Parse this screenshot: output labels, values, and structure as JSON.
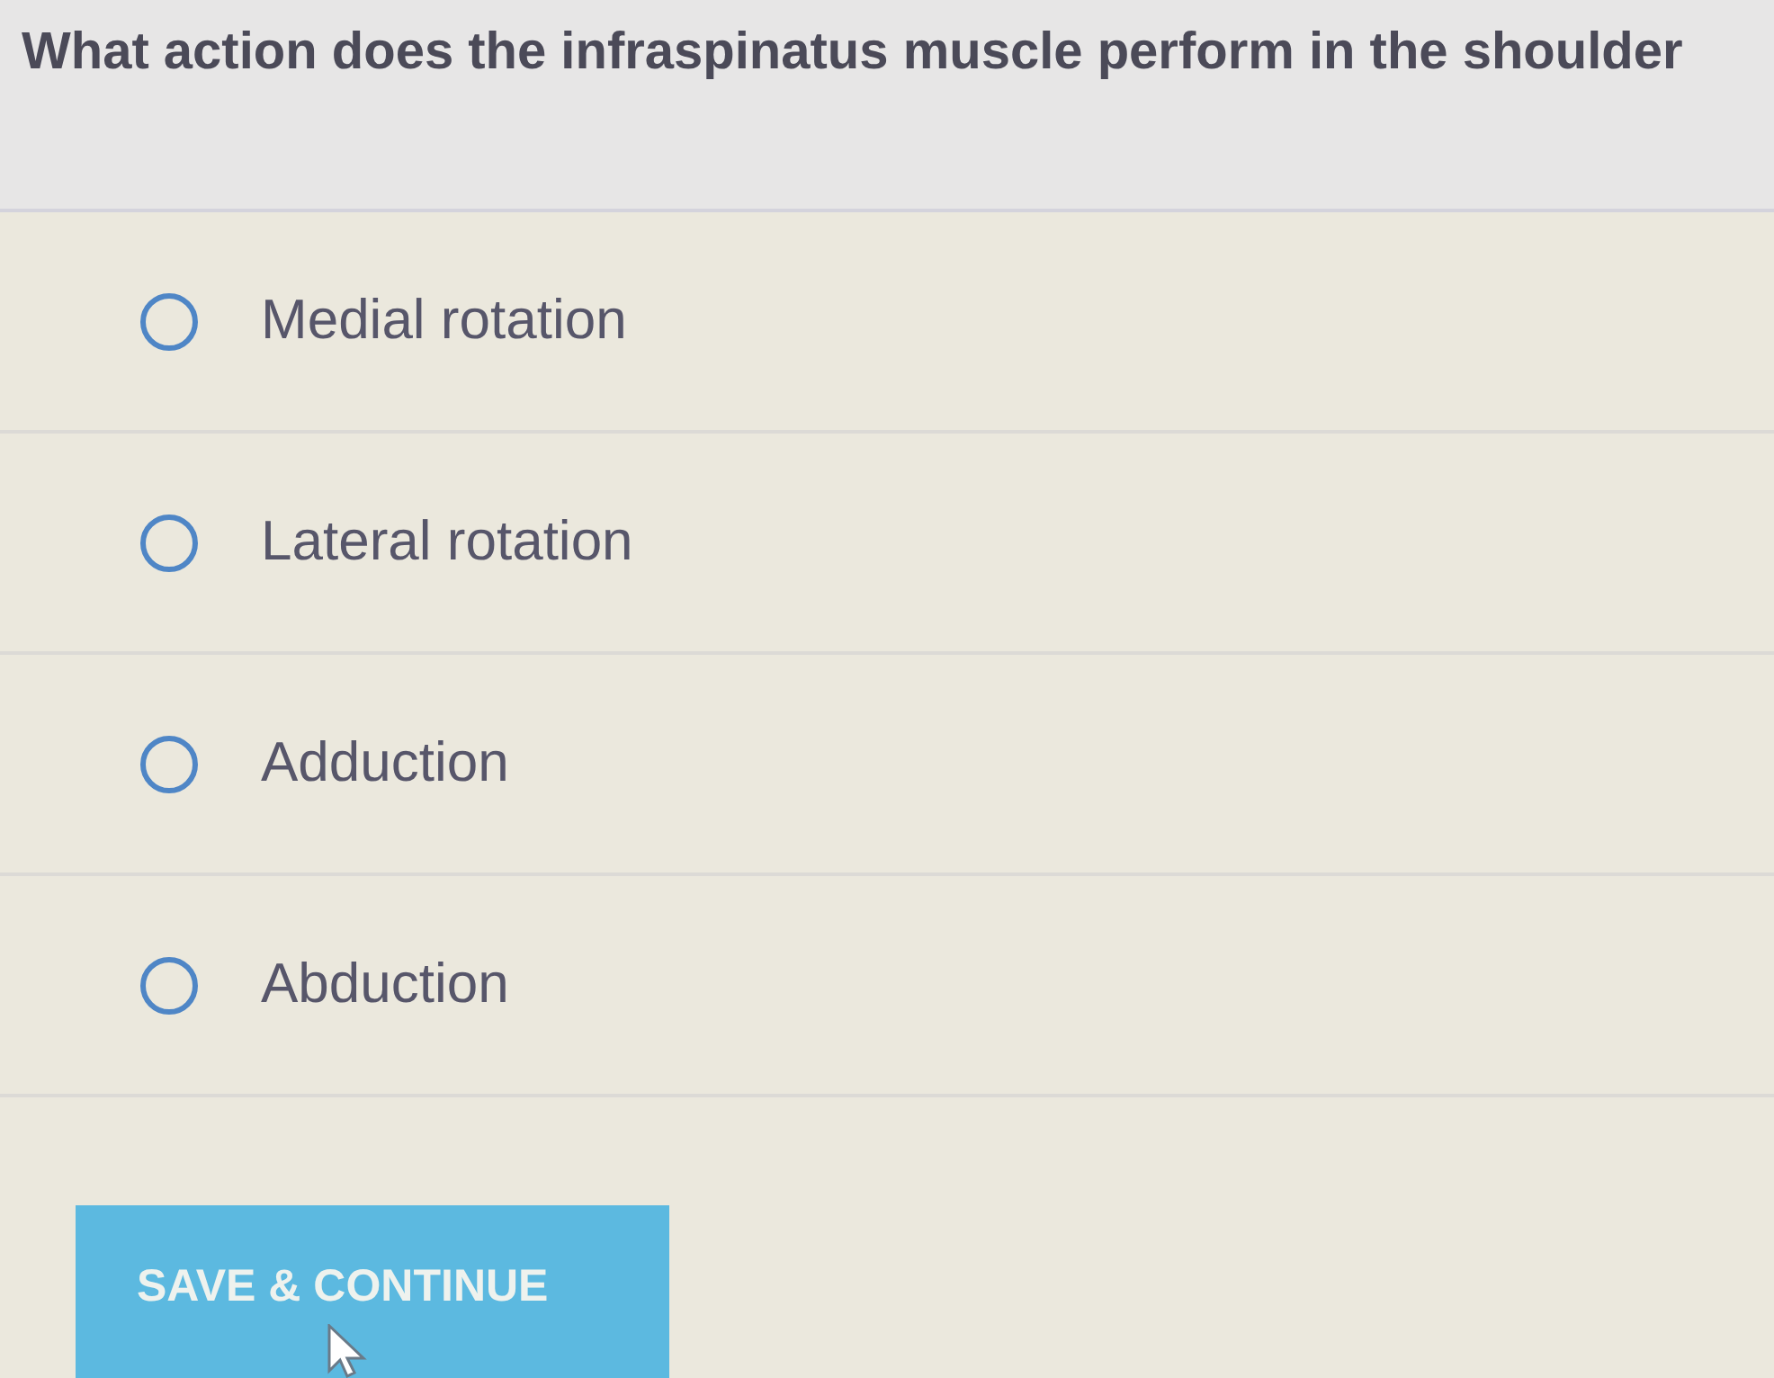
{
  "question": {
    "text": "What action does the infraspinatus muscle perform in the shoulder"
  },
  "options": [
    {
      "label": "Medial rotation",
      "selected": false
    },
    {
      "label": "Lateral rotation",
      "selected": false
    },
    {
      "label": "Adduction",
      "selected": false
    },
    {
      "label": "Abduction",
      "selected": false
    }
  ],
  "button": {
    "label": "SAVE & CONTINUE"
  }
}
